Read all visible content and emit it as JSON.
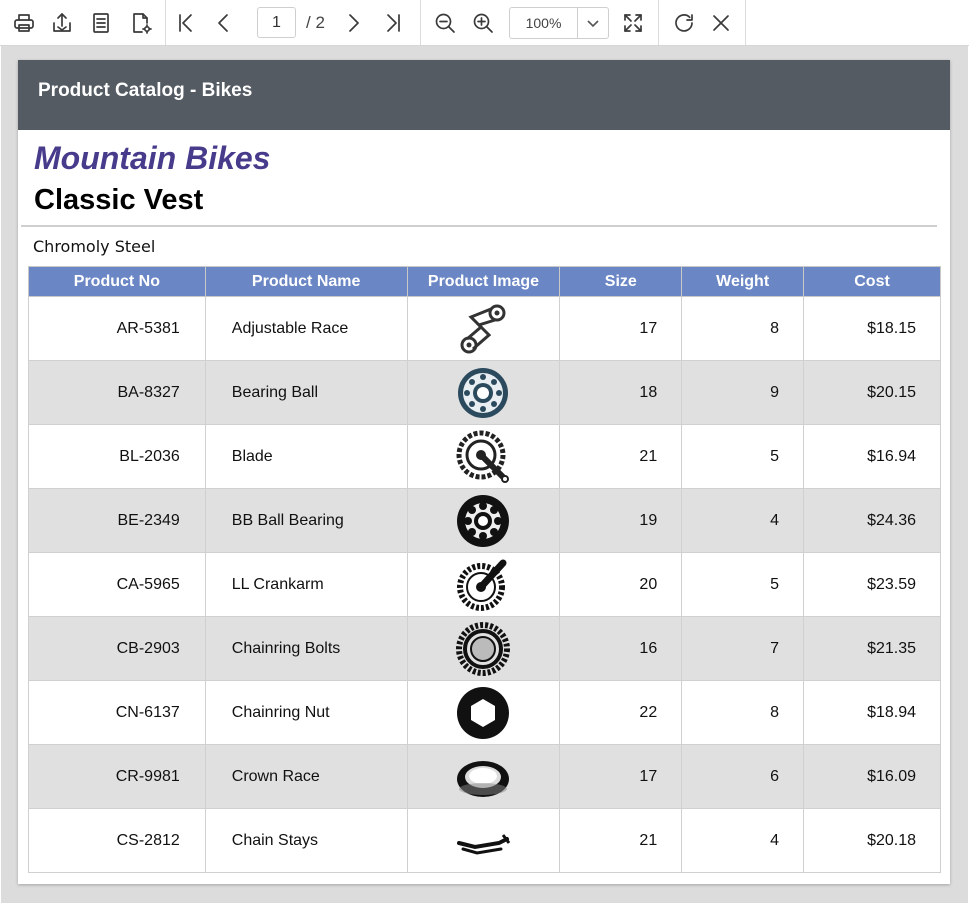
{
  "toolbar": {
    "current_page": "1",
    "total_pages": "/ 2",
    "zoom": "100%",
    "icons": [
      "print-icon",
      "export-icon",
      "page-setup-icon",
      "settings-icon",
      "first-page-icon",
      "previous-page-icon",
      "next-page-icon",
      "last-page-icon",
      "zoom-out-icon",
      "zoom-in-icon",
      "fit-page-icon",
      "refresh-icon",
      "close-icon"
    ]
  },
  "report": {
    "header_title": "Product Catalog - Bikes",
    "category": "Mountain Bikes",
    "subcategory": "Classic Vest",
    "material": "Chromoly Steel",
    "columns": [
      "Product No",
      "Product Name",
      "Product Image",
      "Size",
      "Weight",
      "Cost"
    ],
    "rows": [
      {
        "no": "AR-5381",
        "name": "Adjustable Race",
        "image": "chain-icon",
        "size": "17",
        "weight": "8",
        "cost": "$18.15"
      },
      {
        "no": "BA-8327",
        "name": "Bearing Ball",
        "image": "bearing-icon",
        "size": "18",
        "weight": "9",
        "cost": "$20.15"
      },
      {
        "no": "BL-2036",
        "name": "Blade",
        "image": "crankset-icon",
        "size": "21",
        "weight": "5",
        "cost": "$16.94"
      },
      {
        "no": "BE-2349",
        "name": "BB Ball Bearing",
        "image": "ball-bearing-icon",
        "size": "19",
        "weight": "4",
        "cost": "$24.36"
      },
      {
        "no": "CA-5965",
        "name": "LL Crankarm",
        "image": "crankarm-icon",
        "size": "20",
        "weight": "5",
        "cost": "$23.59"
      },
      {
        "no": "CB-2903",
        "name": "Chainring Bolts",
        "image": "chainring-icon",
        "size": "16",
        "weight": "7",
        "cost": "$21.35"
      },
      {
        "no": "CN-6137",
        "name": "Chainring Nut",
        "image": "hex-nut-icon",
        "size": "22",
        "weight": "8",
        "cost": "$18.94"
      },
      {
        "no": "CR-9981",
        "name": "Crown Race",
        "image": "crown-race-icon",
        "size": "17",
        "weight": "6",
        "cost": "$16.09"
      },
      {
        "no": "CS-2812",
        "name": "Chain Stays",
        "image": "chain-stay-icon",
        "size": "21",
        "weight": "4",
        "cost": "$20.18"
      }
    ]
  }
}
